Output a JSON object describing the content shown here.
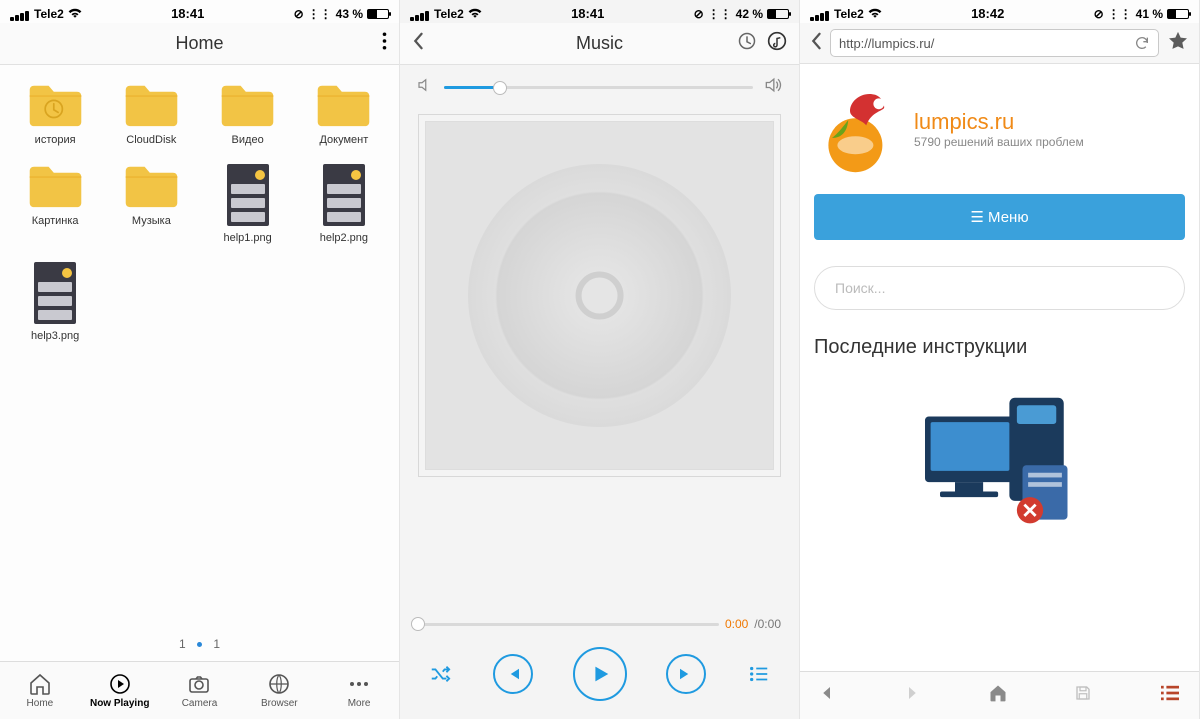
{
  "panel1": {
    "status": {
      "carrier": "Tele2",
      "time": "18:41",
      "battery": "43 %"
    },
    "title": "Home",
    "items": [
      {
        "label": "история",
        "type": "folder",
        "variant": "history"
      },
      {
        "label": "CloudDisk",
        "type": "folder"
      },
      {
        "label": "Видео",
        "type": "folder"
      },
      {
        "label": "Документ",
        "type": "folder"
      },
      {
        "label": "Картинка",
        "type": "folder"
      },
      {
        "label": "Музыка",
        "type": "folder"
      },
      {
        "label": "help1.png",
        "type": "thumb"
      },
      {
        "label": "help2.png",
        "type": "thumb"
      },
      {
        "label": "help3.png",
        "type": "thumb"
      }
    ],
    "pager": {
      "cur": "1",
      "total": "1"
    },
    "tabs": [
      {
        "label": "Home"
      },
      {
        "label": "Now Playing"
      },
      {
        "label": "Camera"
      },
      {
        "label": "Browser"
      },
      {
        "label": "More"
      }
    ]
  },
  "panel2": {
    "status": {
      "carrier": "Tele2",
      "time": "18:41",
      "battery": "42 %"
    },
    "title": "Music",
    "volume": 18,
    "time_cur": "0:00",
    "time_tot": "/0:00"
  },
  "panel3": {
    "status": {
      "carrier": "Tele2",
      "time": "18:42",
      "battery": "41 %"
    },
    "url": "http://lumpics.ru/",
    "brand_title": "lumpics.ru",
    "brand_sub": "5790 решений ваших проблем",
    "menu_label": "Меню",
    "search_placeholder": "Поиск...",
    "heading": "Последние инструкции"
  }
}
